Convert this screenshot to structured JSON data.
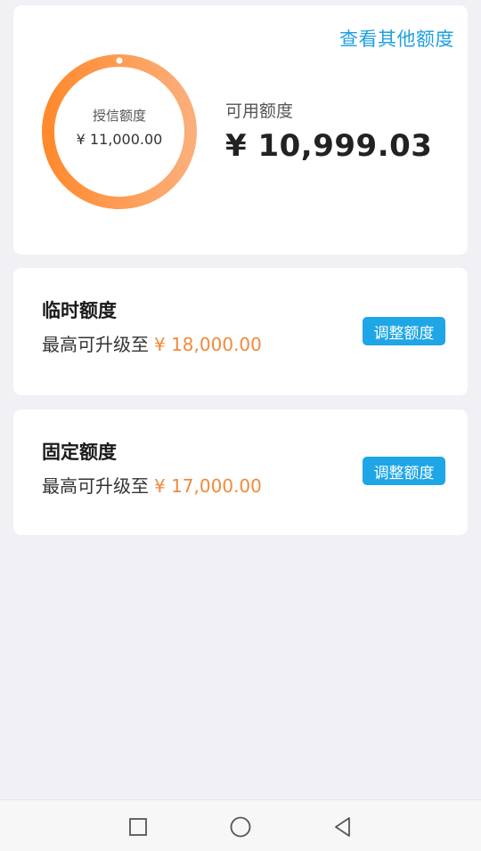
{
  "summary": {
    "other_link": "查看其他额度",
    "ring_label": "授信额度",
    "ring_value": "¥ 11,000.00",
    "available_label": "可用额度",
    "available_value": "¥ 10,999.03",
    "used_fraction": 0.0001,
    "ring_gradient": [
      "#ff8a2e",
      "#fcae7a"
    ]
  },
  "temporary": {
    "title": "临时额度",
    "desc_prefix": "最高可升级至",
    "amount": "¥ 18,000.00",
    "button": "调整额度"
  },
  "fixed": {
    "title": "固定额度",
    "desc_prefix": "最高可升级至",
    "amount": "¥ 17,000.00",
    "button": "调整额度"
  },
  "colors": {
    "accent_blue": "#1ea6e6",
    "amount_orange": "#f08a3c",
    "background": "#f0f0f5"
  },
  "navbar": {
    "icons": [
      "square-icon",
      "circle-icon",
      "back-triangle-icon"
    ]
  }
}
